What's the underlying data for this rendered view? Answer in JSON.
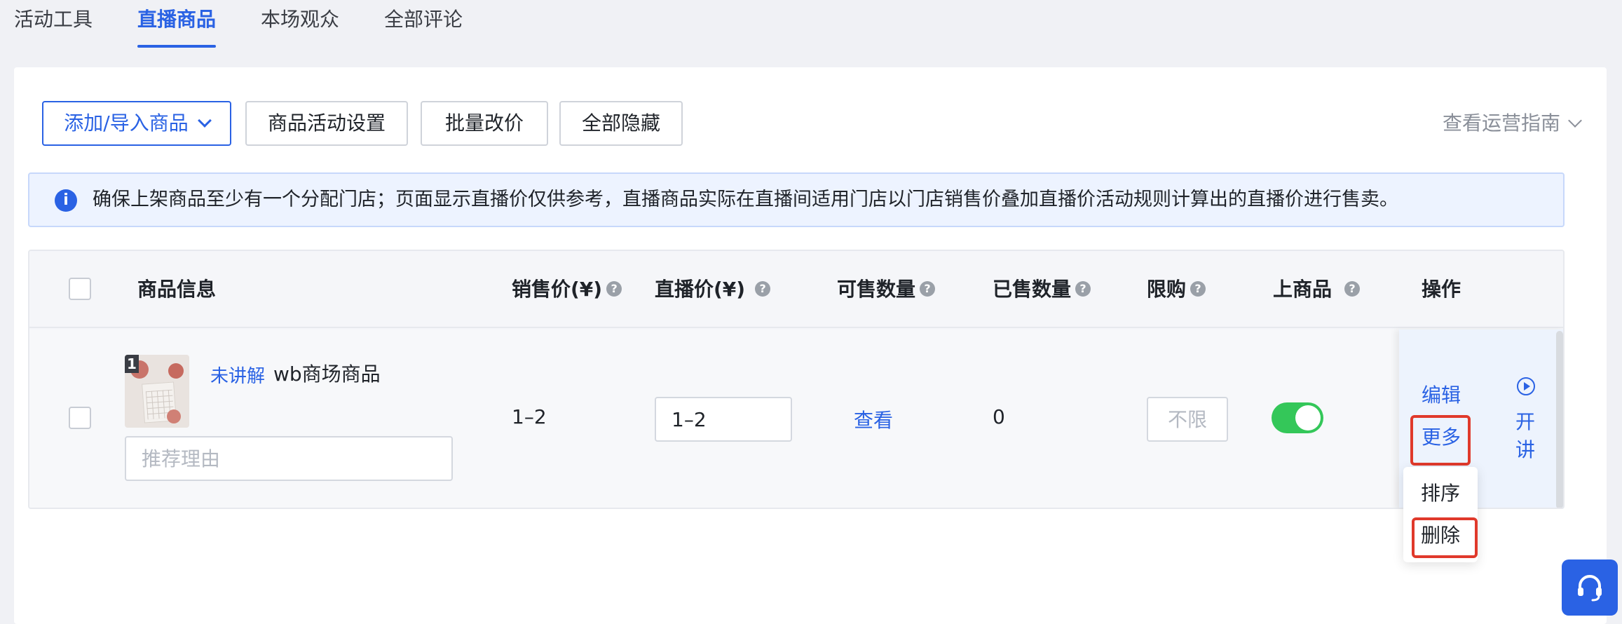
{
  "tabs": [
    "活动工具",
    "直播商品",
    "本场观众",
    "全部评论"
  ],
  "toolbar": {
    "add_import": "添加/导入商品",
    "activity_settings": "商品活动设置",
    "batch_price": "批量改价",
    "hide_all": "全部隐藏",
    "guide": "查看运营指南"
  },
  "notice": "确保上架商品至少有一个分配门店；页面显示直播价仅供参考，直播商品实际在直播间适用门店以门店销售价叠加直播价活动规则计算出的直播价进行售卖。",
  "table": {
    "headers": {
      "product_info": "商品信息",
      "sale_price": "销售价(¥)",
      "live_price": "直播价(¥)",
      "available_qty": "可售数量",
      "sold_qty": "已售数量",
      "limit": "限购",
      "on_shelf": "上商品",
      "actions": "操作"
    },
    "row": {
      "index": "1",
      "status": "未讲解",
      "name": "wb商场商品",
      "reason_placeholder": "推荐理由",
      "sale_price": "1–2",
      "live_price": "1–2",
      "available_qty": "查看",
      "sold_qty": "0",
      "limit_placeholder": "不限",
      "on_shelf": true,
      "actions": {
        "edit": "编辑",
        "more": "更多",
        "start_1": "开",
        "start_2": "讲"
      }
    }
  },
  "more_menu": [
    "排序",
    "删除"
  ],
  "colors": {
    "primary": "#2a62e4",
    "toggle_on": "#34c759",
    "highlight": "#e0392b"
  }
}
